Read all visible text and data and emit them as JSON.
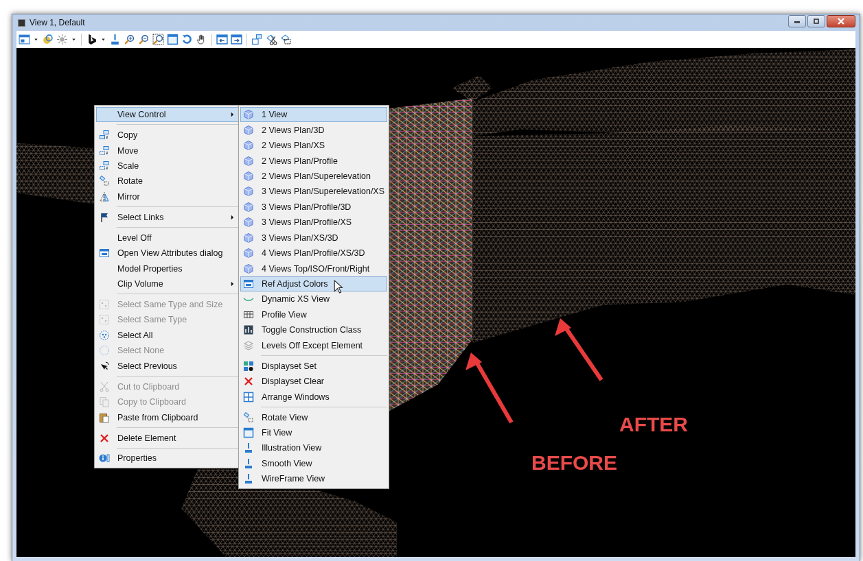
{
  "window": {
    "title": "View 1, Default"
  },
  "context_menu": {
    "groups": [
      [
        {
          "label": "View Control",
          "selected": true,
          "disabled": false,
          "submenu": true
        }
      ],
      [
        {
          "label": "Copy",
          "selected": false,
          "disabled": false,
          "submenu": false
        },
        {
          "label": "Move",
          "selected": false,
          "disabled": false,
          "submenu": false
        },
        {
          "label": "Scale",
          "selected": false,
          "disabled": false,
          "submenu": false
        },
        {
          "label": "Rotate",
          "selected": false,
          "disabled": false,
          "submenu": false
        },
        {
          "label": "Mirror",
          "selected": false,
          "disabled": false,
          "submenu": false
        }
      ],
      [
        {
          "label": "Select Links",
          "selected": false,
          "disabled": false,
          "submenu": true
        }
      ],
      [
        {
          "label": "Level Off",
          "selected": false,
          "disabled": false,
          "submenu": false
        },
        {
          "label": "Open View Attributes dialog",
          "selected": false,
          "disabled": false,
          "submenu": false
        },
        {
          "label": "Model Properties",
          "selected": false,
          "disabled": false,
          "submenu": false
        },
        {
          "label": "Clip Volume",
          "selected": false,
          "disabled": false,
          "submenu": true
        }
      ],
      [
        {
          "label": "Select Same Type and Size",
          "selected": false,
          "disabled": true,
          "submenu": false
        },
        {
          "label": "Select Same Type",
          "selected": false,
          "disabled": true,
          "submenu": false
        },
        {
          "label": "Select All",
          "selected": false,
          "disabled": false,
          "submenu": false
        },
        {
          "label": "Select None",
          "selected": false,
          "disabled": true,
          "submenu": false
        },
        {
          "label": "Select Previous",
          "selected": false,
          "disabled": false,
          "submenu": false
        }
      ],
      [
        {
          "label": "Cut to Clipboard",
          "selected": false,
          "disabled": true,
          "submenu": false
        },
        {
          "label": "Copy to Clipboard",
          "selected": false,
          "disabled": true,
          "submenu": false
        },
        {
          "label": "Paste from Clipboard",
          "selected": false,
          "disabled": false,
          "submenu": false
        }
      ],
      [
        {
          "label": "Delete Element",
          "selected": false,
          "disabled": false,
          "submenu": false
        }
      ],
      [
        {
          "label": "Properties",
          "selected": false,
          "disabled": false,
          "submenu": false
        }
      ]
    ]
  },
  "submenu": {
    "groups": [
      [
        {
          "label": "1 View",
          "selected": true,
          "disabled": false
        },
        {
          "label": "2 Views Plan/3D",
          "selected": false,
          "disabled": false
        },
        {
          "label": "2 Views Plan/XS",
          "selected": false,
          "disabled": false
        },
        {
          "label": "2 Views Plan/Profile",
          "selected": false,
          "disabled": false
        },
        {
          "label": "2 Views Plan/Superelevation",
          "selected": false,
          "disabled": false
        },
        {
          "label": "3 Views Plan/Superelevation/XS",
          "selected": false,
          "disabled": false
        },
        {
          "label": "3 Views Plan/Profile/3D",
          "selected": false,
          "disabled": false
        },
        {
          "label": "3 Views Plan/Profile/XS",
          "selected": false,
          "disabled": false
        },
        {
          "label": "3 Views Plan/XS/3D",
          "selected": false,
          "disabled": false
        },
        {
          "label": "4 Views Plan/Profile/XS/3D",
          "selected": false,
          "disabled": false
        },
        {
          "label": "4 Views Top/ISO/Front/Right",
          "selected": false,
          "disabled": false
        },
        {
          "label": "Ref Adjust Colors",
          "selected": true,
          "disabled": false
        },
        {
          "label": "Dynamic XS View",
          "selected": false,
          "disabled": false
        },
        {
          "label": "Profile View",
          "selected": false,
          "disabled": false
        },
        {
          "label": "Toggle Construction Class",
          "selected": false,
          "disabled": false
        },
        {
          "label": "Levels Off Except Element",
          "selected": false,
          "disabled": false
        }
      ],
      [
        {
          "label": "Displayset Set",
          "selected": false,
          "disabled": false
        },
        {
          "label": "Displayset Clear",
          "selected": false,
          "disabled": false
        },
        {
          "label": "Arrange Windows",
          "selected": false,
          "disabled": false
        }
      ],
      [
        {
          "label": "Rotate View",
          "selected": false,
          "disabled": false
        },
        {
          "label": "Fit View",
          "selected": false,
          "disabled": false
        },
        {
          "label": "Illustration View",
          "selected": false,
          "disabled": false
        },
        {
          "label": "Smooth View",
          "selected": false,
          "disabled": false
        },
        {
          "label": "WireFrame View",
          "selected": false,
          "disabled": false
        }
      ]
    ]
  },
  "annotations": [
    {
      "label": "BEFORE"
    },
    {
      "label": "AFTER"
    }
  ]
}
